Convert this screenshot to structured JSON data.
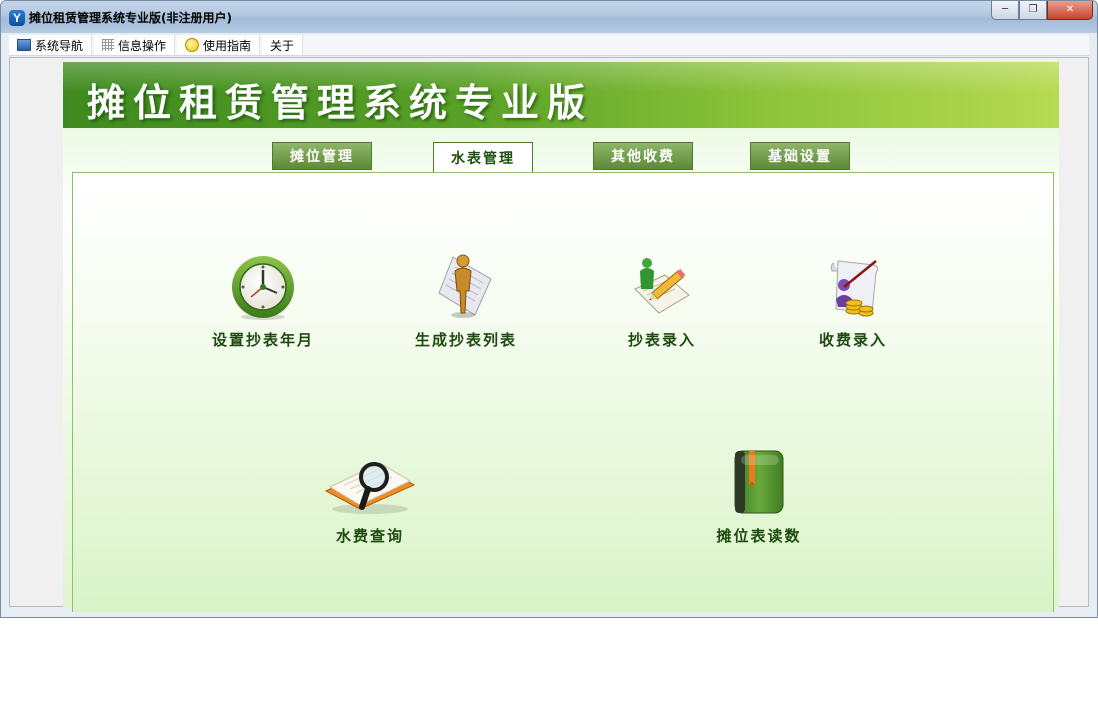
{
  "window": {
    "app_icon": "app-logo-icon",
    "icon_letter": "Y",
    "title": "摊位租赁管理系统专业版(非注册用户)",
    "controls": {
      "minimize": "─",
      "restore": "❐",
      "close": "✕"
    }
  },
  "menu": {
    "items": [
      {
        "label": "系统导航",
        "icon": "navigation-window-icon"
      },
      {
        "label": "信息操作",
        "icon": "grid-icon"
      },
      {
        "label": "使用指南",
        "icon": "help-icon"
      },
      {
        "label": "关于",
        "icon": ""
      }
    ]
  },
  "banner": {
    "title": "摊位租赁管理系统专业版"
  },
  "tabs": [
    {
      "label": "摊位管理",
      "active": false
    },
    {
      "label": "水表管理",
      "active": true
    },
    {
      "label": "其他收费",
      "active": false
    },
    {
      "label": "基础设置",
      "active": false
    }
  ],
  "functions": [
    {
      "label": "设置抄表年月",
      "icon": "clock-icon"
    },
    {
      "label": "生成抄表列表",
      "icon": "person-document-icon"
    },
    {
      "label": "抄表录入",
      "icon": "pencil-document-icon"
    },
    {
      "label": "收费录入",
      "icon": "coins-receipt-icon"
    },
    {
      "label": "水费查询",
      "icon": "magnifier-document-icon"
    },
    {
      "label": "摊位表读数",
      "icon": "green-book-icon"
    }
  ],
  "colors": {
    "banner_start": "#3f8a1f",
    "banner_end": "#b7da52",
    "label_text": "#1e4a10",
    "tab_active_text": "#1f5010"
  }
}
